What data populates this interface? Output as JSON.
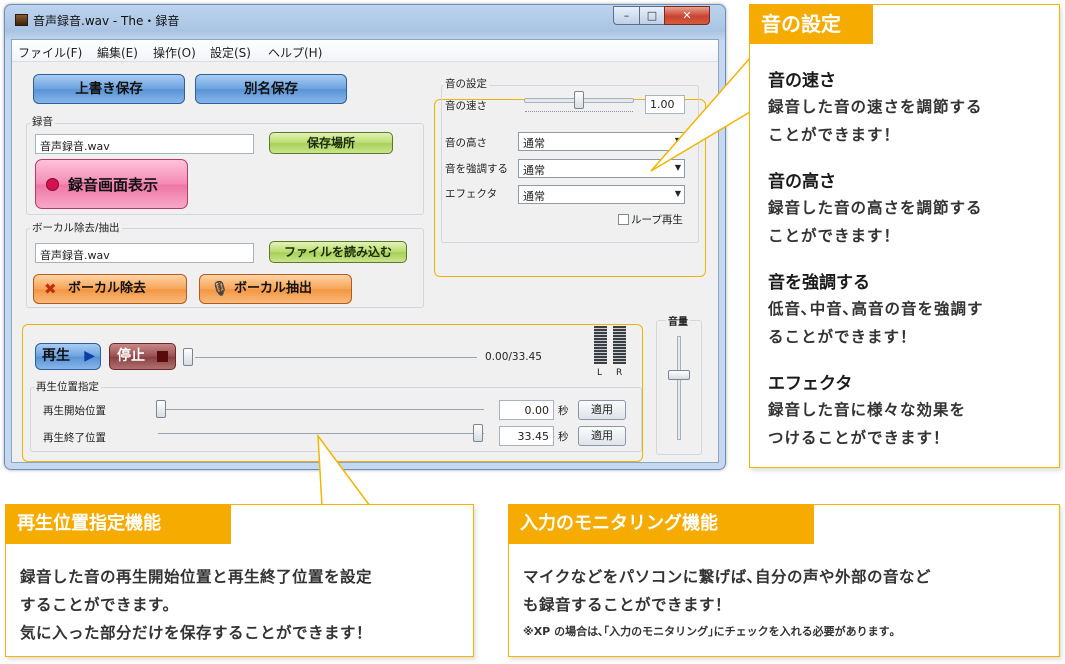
{
  "window": {
    "title": "音声録音.wav - The・録音",
    "controls": {
      "minimize": "–",
      "maximize": "□",
      "close": "✕"
    }
  },
  "menubar": [
    "ファイル(F)",
    "編集(E)",
    "操作(O)",
    "設定(S)",
    "ヘルプ(H)"
  ],
  "toolbar": {
    "overwrite_save": "上書き保存",
    "save_as": "別名保存"
  },
  "recording": {
    "group_label": "録音",
    "filename": "音声録音.wav",
    "save_location_button": "保存場所",
    "show_record_screen_button": "録音画面表示"
  },
  "vocal": {
    "group_label": "ボーカル除去/抽出",
    "filename": "音声録音.wav",
    "load_file_button": "ファイルを読み込む",
    "remove_button": "ボーカル除去",
    "extract_button": "ボーカル抽出"
  },
  "sound_settings": {
    "group_label": "音の設定",
    "speed_label": "音の速さ",
    "speed_value": "1.00",
    "pitch_label": "音の高さ",
    "pitch_value": "通常",
    "emphasis_label": "音を強調する",
    "emphasis_value": "通常",
    "effect_label": "エフェクタ",
    "effect_value": "通常",
    "loop_label": "ループ再生"
  },
  "playback": {
    "play_button": "再生",
    "stop_button": "停止",
    "time": "0.00/33.45",
    "position_group_label": "再生位置指定",
    "start_label": "再生開始位置",
    "start_value": "0.00",
    "end_label": "再生終了位置",
    "end_value": "33.45",
    "seconds_unit": "秒",
    "apply_button": "適用",
    "progress_fraction": 0
  },
  "meter": {
    "left": "L",
    "right": "R"
  },
  "volume": {
    "label": "音量",
    "level_fraction": 0.5
  },
  "callouts": {
    "sound_settings": {
      "tag": "音の設定",
      "items": [
        {
          "heading": "音の速さ",
          "lines": [
            "録音した音の速さを調節する",
            "ことができます！"
          ]
        },
        {
          "heading": "音の高さ",
          "lines": [
            "録音した音の高さを調節する",
            "ことができます！"
          ]
        },
        {
          "heading": "音を強調する",
          "lines": [
            "低音､中音､高音の音を強調す",
            "ることができます！"
          ]
        },
        {
          "heading": "エフェクタ",
          "lines": [
            "録音した音に様々な効果を",
            "つけることができます！"
          ]
        }
      ]
    },
    "playback_position": {
      "tag": "再生位置指定機能",
      "lines": [
        "録音した音の再生開始位置と再生終了位置を設定",
        "することができます。",
        "気に入った部分だけを保存することができます！"
      ]
    },
    "input_monitoring": {
      "tag": "入力のモニタリング機能",
      "lines": [
        "マイクなどをパソコンに繋げば､自分の声や外部の音など",
        "も録音することができます！"
      ],
      "note": "※XP の場合は､｢入力のモニタリング｣にチェックを入れる必要があります｡"
    }
  },
  "colors": {
    "accent": "#f5ab00",
    "panel_border": "#f2b600"
  }
}
